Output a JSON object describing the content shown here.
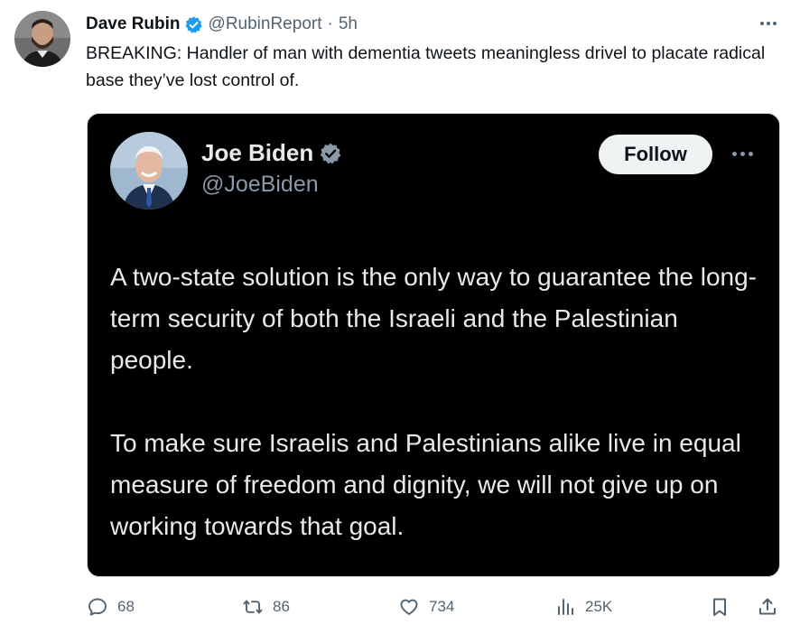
{
  "tweet": {
    "author_name": "Dave Rubin",
    "author_handle": "@RubinReport",
    "separator": "·",
    "time": "5h",
    "text": "BREAKING: Handler of man with dementia tweets meaningless drivel to placate radical base they’ve lost control of."
  },
  "embedded": {
    "author_name": "Joe Biden",
    "author_handle": "@JoeBiden",
    "follow_label": "Follow",
    "paragraphs": [
      "A two-state solution is the only way to guarantee the long-term security of both the Israeli and the Palestinian people.",
      "To make sure Israelis and Palestinians alike live in equal measure of freedom and dignity, we will not give up on working towards that goal."
    ]
  },
  "actions": {
    "replies": "68",
    "reposts": "86",
    "likes": "734",
    "views": "25K"
  },
  "icons": [
    "verified-badge-icon",
    "more-icon",
    "reply-icon",
    "repost-icon",
    "like-icon",
    "views-icon",
    "bookmark-icon",
    "share-icon"
  ],
  "colors": {
    "verified": "#1d9bf0",
    "secondary_text": "#536471",
    "embed_background": "#000000",
    "embed_text": "#e7e9ea"
  }
}
